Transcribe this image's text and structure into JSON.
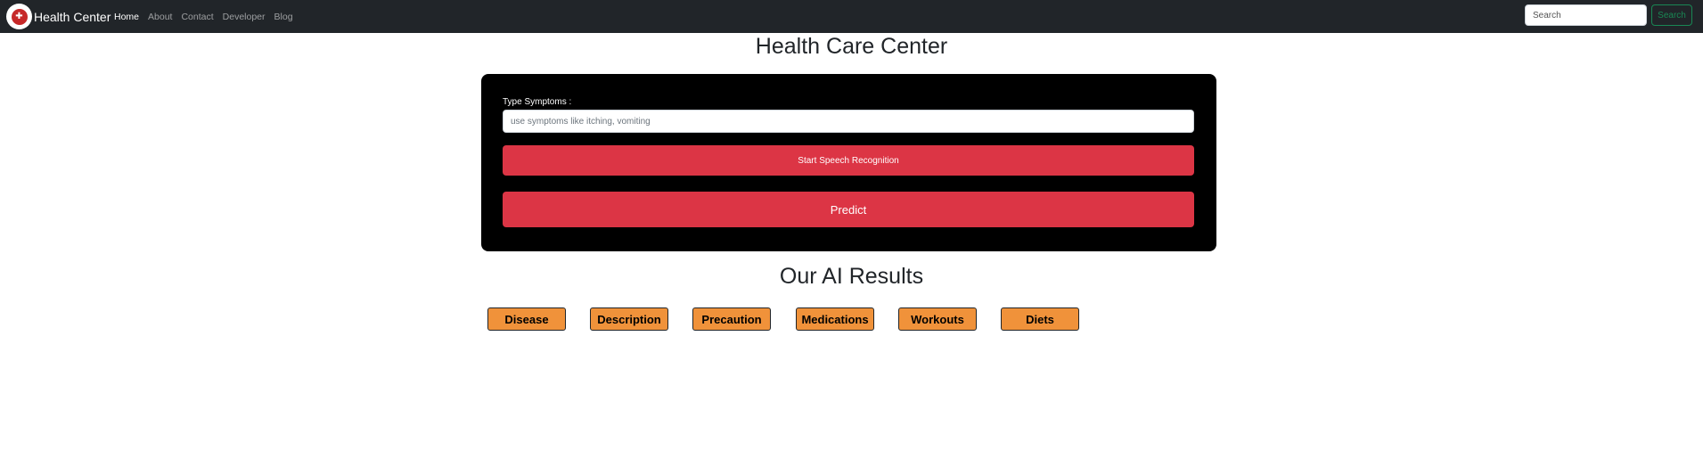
{
  "navbar": {
    "brand": "Health Center",
    "logo_icon": "health-logo-icon",
    "links": [
      "Home",
      "About",
      "Contact",
      "Developer",
      "Blog"
    ],
    "active_link": "Home",
    "search_placeholder": "Search",
    "search_button": "Search"
  },
  "main": {
    "title": "Health Care Center",
    "form": {
      "label": "Type Symptoms :",
      "input_placeholder": "use symptoms like itching, vomiting",
      "speech_button": "Start Speech Recognition",
      "predict_button": "Predict"
    }
  },
  "results": {
    "title": "Our AI Results",
    "buttons": [
      "Disease",
      "Description",
      "Precaution",
      "Medications",
      "Workouts",
      "Diets"
    ]
  },
  "colors": {
    "navbar_bg": "#212529",
    "card_bg": "#000000",
    "danger": "#dc3545",
    "result_button": "#f0923a",
    "search_button": "#198754"
  }
}
